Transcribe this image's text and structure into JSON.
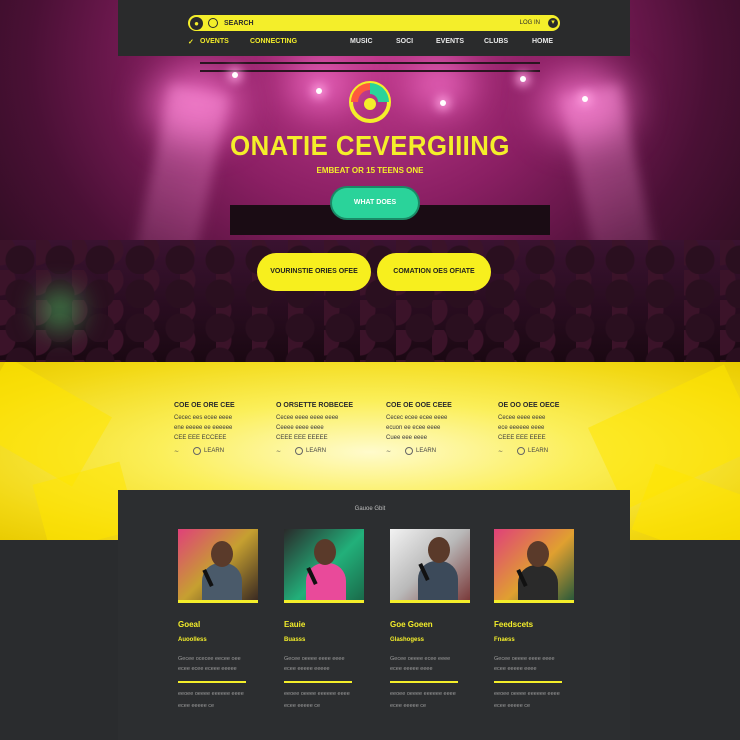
{
  "nav": {
    "search_placeholder": "SEARCH",
    "search_right": "LOG IN",
    "items": [
      "OVENTS",
      "CONNECTING",
      "MUSIC",
      "SOCI",
      "EVENTS",
      "CLUBS",
      "HOME"
    ]
  },
  "hero": {
    "title": "ONATIE CEVERGIIING",
    "subtitle": "EMBEAT OR 15 TEENS ONE",
    "cta": "WHAT DOES",
    "pill_left": "VOURINSTIE ORIES OFEE",
    "pill_right": "COMATION OES OFIATE"
  },
  "features": [
    {
      "title": "COE OE ORE CEE",
      "lines": [
        "Cecec ees ecee eeee",
        "ene eeeee ee eeeeee",
        "CEE EEE ECCEEE"
      ],
      "link": "LEARN"
    },
    {
      "title": "O ORSETTE ROBECEE",
      "lines": [
        "Cecee eeee eeee eeee",
        "Ceeee eeee eeee",
        "CEEE EEE EEEEE"
      ],
      "link": "LEARN"
    },
    {
      "title": "COE OE OOE CEEE",
      "lines": [
        "Cecec ecee ecee eeee",
        "ecuon ee ecee eeee",
        "Cuee eee eeee"
      ],
      "link": "LEARN"
    },
    {
      "title": "OE OO OEE OECE",
      "lines": [
        "Cecee eeee eeee",
        "ece eeeeee eeee",
        "CEEE EEE EEEE"
      ],
      "link": "LEARN"
    }
  ],
  "gallery": {
    "label": "Gauoe Gbit",
    "cards": [
      {
        "title": "Goeal",
        "sub": "Auoolless",
        "text": [
          "Gecee ocecee eecee oee",
          "ecee ecee eceee eeeee"
        ],
        "text2": [
          "eeoee oeeee eeeeee eeee",
          "ecee eeeee ce"
        ]
      },
      {
        "title": "Eauie",
        "sub": "Buasss",
        "text": [
          "Gecee oeeee eeee eeee",
          "ecee eeeee eeeee"
        ],
        "text2": [
          "eeoee oeeee eeeeee eeee",
          "ecee eeeee ce"
        ]
      },
      {
        "title": "Goe Goeen",
        "sub": "Glashogess",
        "text": [
          "Gecee oeeee ecee eeee",
          "ecee eeeee eeee"
        ],
        "text2": [
          "eeoee oeeee eeeeee eeee",
          "ecee eeeee ce"
        ]
      },
      {
        "title": "Feedscets",
        "sub": "Fnaess",
        "text": [
          "Gecee oeeee eeee eeee",
          "ecee eeeee eeee"
        ],
        "text2": [
          "eeoee oeeee eeeeee eeee",
          "ecee eeeee ce"
        ]
      }
    ]
  },
  "colors": {
    "accent": "#f4ee2a",
    "cta": "#2ad39a",
    "dark": "#2c2e30",
    "magenta": "#c23a8e"
  }
}
